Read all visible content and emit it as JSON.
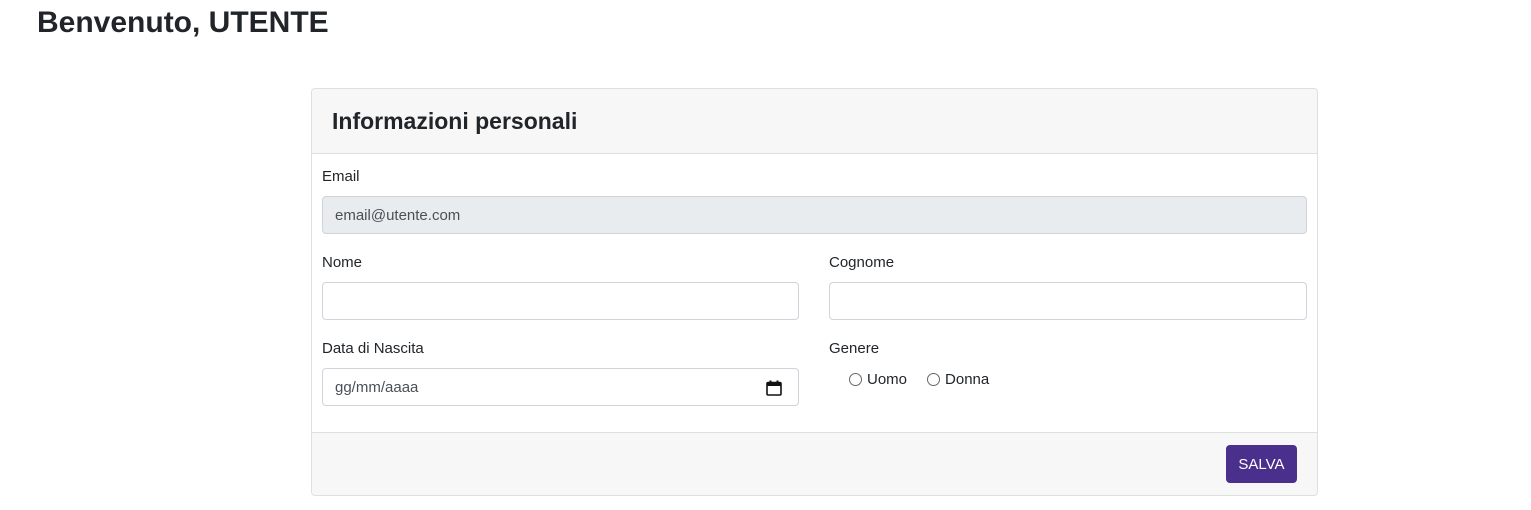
{
  "page": {
    "welcome": "Benvenuto, UTENTE"
  },
  "card": {
    "title": "Informazioni personali",
    "email": {
      "label": "Email",
      "value": "email@utente.com"
    },
    "nome": {
      "label": "Nome",
      "value": ""
    },
    "cognome": {
      "label": "Cognome",
      "value": ""
    },
    "data_nascita": {
      "label": "Data di Nascita",
      "placeholder": "gg/mm/aaaa",
      "icon": "calendar-icon"
    },
    "genere": {
      "label": "Genere",
      "options": [
        {
          "label": "Uomo",
          "checked": false
        },
        {
          "label": "Donna",
          "checked": false
        }
      ]
    },
    "save_label": "SALVA"
  },
  "colors": {
    "primary_button": "#4b2f8c",
    "disabled_input": "#e9ecef",
    "card_header": "#f7f7f7"
  }
}
